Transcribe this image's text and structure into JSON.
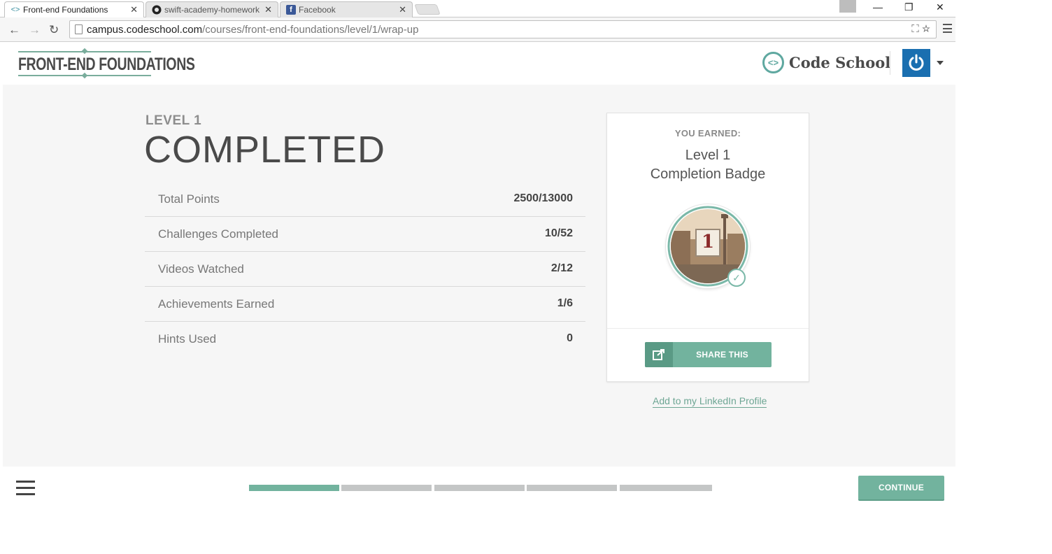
{
  "browser": {
    "tabs": [
      {
        "title": "Front-end Foundations",
        "icon": "code-brackets-icon",
        "active": true
      },
      {
        "title": "swift-academy-homework",
        "icon": "github-icon",
        "active": false
      },
      {
        "title": "Facebook",
        "icon": "facebook-icon",
        "active": false
      }
    ],
    "url_host": "campus.codeschool.com",
    "url_path": "/courses/front-end-foundations/level/1/wrap-up"
  },
  "header": {
    "course_logo": "FRONT-END FOUNDATIONS",
    "brand_name": "Code School"
  },
  "level": {
    "label": "LEVEL 1",
    "status": "COMPLETED"
  },
  "stats": [
    {
      "label": "Total Points",
      "value": "2500/13000"
    },
    {
      "label": "Challenges Completed",
      "value": "10/52"
    },
    {
      "label": "Videos Watched",
      "value": "2/12"
    },
    {
      "label": "Achievements Earned",
      "value": "1/6"
    },
    {
      "label": "Hints Used",
      "value": "0"
    }
  ],
  "badge": {
    "earned_label": "YOU EARNED:",
    "name_line1": "Level 1",
    "name_line2": "Completion Badge",
    "badge_number": "1",
    "share_label": "SHARE THIS",
    "linkedin_label": "Add to my LinkedIn Profile"
  },
  "footer": {
    "progress_segments": 5,
    "progress_completed": 1,
    "continue_label": "CONTINUE"
  },
  "colors": {
    "accent_green": "#72b39e",
    "brand_blue": "#1a6fb0",
    "panel_bg": "#f6f6f6"
  }
}
